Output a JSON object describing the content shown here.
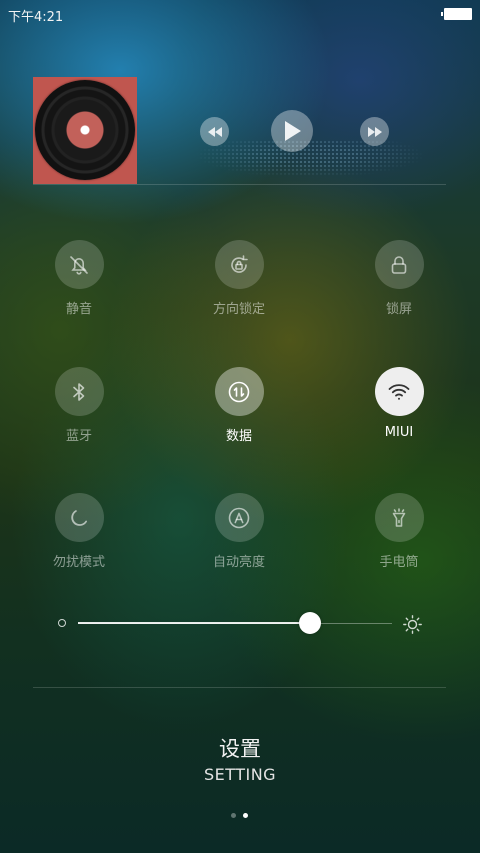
{
  "status_bar": {
    "time": "下午4:21"
  },
  "music": {
    "prev_icon": "prev-icon",
    "play_icon": "play-icon",
    "next_icon": "next-icon"
  },
  "toggles": [
    {
      "label": "静音",
      "icon": "bell-off-icon",
      "state": "off"
    },
    {
      "label": "方向锁定",
      "icon": "rotation-lock-icon",
      "state": "off"
    },
    {
      "label": "锁屏",
      "icon": "lock-icon",
      "state": "off"
    },
    {
      "label": "蓝牙",
      "icon": "bluetooth-icon",
      "state": "off"
    },
    {
      "label": "数据",
      "icon": "data-transfer-icon",
      "state": "on"
    },
    {
      "label": "MIUI",
      "icon": "wifi-icon",
      "state": "on"
    },
    {
      "label": "勿扰模式",
      "icon": "moon-icon",
      "state": "off"
    },
    {
      "label": "自动亮度",
      "icon": "auto-brightness-icon",
      "state": "off"
    },
    {
      "label": "手电筒",
      "icon": "flashlight-icon",
      "state": "off"
    }
  ],
  "brightness": {
    "level_fraction": 0.74
  },
  "settings": {
    "title": "设置",
    "subtitle": "SETTING"
  },
  "pager": {
    "pages": 2,
    "current": 2
  }
}
